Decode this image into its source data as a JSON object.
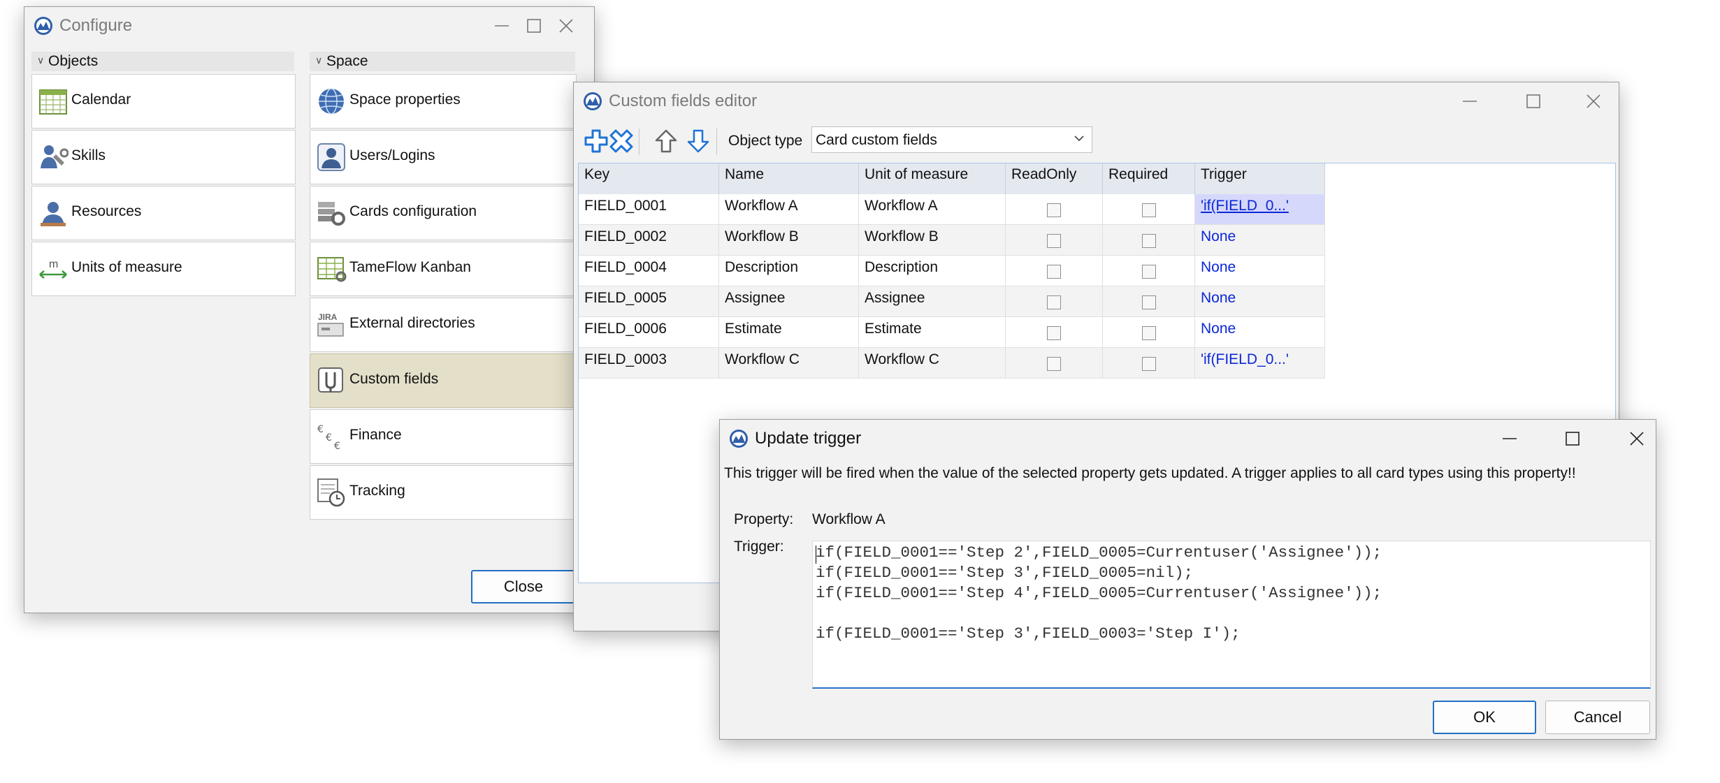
{
  "configure": {
    "title": "Configure",
    "objects_header": "Objects",
    "space_header": "Space",
    "objects": [
      {
        "label": "Calendar",
        "icon": "calendar-icon"
      },
      {
        "label": "Skills",
        "icon": "skills-icon"
      },
      {
        "label": "Resources",
        "icon": "resources-icon"
      },
      {
        "label": "Units of measure",
        "icon": "ruler-icon"
      }
    ],
    "space": [
      {
        "label": "Space properties",
        "icon": "globe-icon"
      },
      {
        "label": "Users/Logins",
        "icon": "user-icon"
      },
      {
        "label": "Cards configuration",
        "icon": "cards-gear-icon"
      },
      {
        "label": "TameFlow Kanban",
        "icon": "kanban-board-icon"
      },
      {
        "label": "External directories",
        "icon": "jira-icon"
      },
      {
        "label": "Custom fields",
        "icon": "custom-fields-icon",
        "selected": true
      },
      {
        "label": "Finance",
        "icon": "euro-icon"
      },
      {
        "label": "Tracking",
        "icon": "tracking-clock-icon"
      }
    ],
    "close_label": "Close"
  },
  "custom_fields": {
    "title": "Custom fields editor",
    "object_type_label": "Object type",
    "object_type_value": "Card custom fields",
    "columns": [
      "Key",
      "Name",
      "Unit of measure",
      "ReadOnly",
      "Required",
      "Trigger"
    ],
    "rows": [
      {
        "key": "FIELD_0001",
        "name": "Workflow A",
        "unit": "Workflow A",
        "readonly": false,
        "required": false,
        "trigger": "'if(FIELD_0...'"
      },
      {
        "key": "FIELD_0002",
        "name": "Workflow B",
        "unit": "Workflow B",
        "readonly": false,
        "required": false,
        "trigger": "None"
      },
      {
        "key": "FIELD_0004",
        "name": "Description",
        "unit": "Description",
        "readonly": false,
        "required": false,
        "trigger": "None"
      },
      {
        "key": "FIELD_0005",
        "name": "Assignee",
        "unit": "Assignee",
        "readonly": false,
        "required": false,
        "trigger": "None"
      },
      {
        "key": "FIELD_0006",
        "name": "Estimate",
        "unit": "Estimate",
        "readonly": false,
        "required": false,
        "trigger": "None"
      },
      {
        "key": "FIELD_0003",
        "name": "Workflow C",
        "unit": "Workflow C",
        "readonly": false,
        "required": false,
        "trigger": "'if(FIELD_0...'"
      }
    ]
  },
  "update_trigger": {
    "title": "Update trigger",
    "message": "This trigger will be fired when the value of the selected property gets updated. A trigger applies to all card types using this property!!",
    "property_label": "Property:",
    "property_value": "Workflow A",
    "trigger_label": "Trigger:",
    "code_lines": [
      "if(FIELD_0001=='Step 2',FIELD_0005=Currentuser('Assignee'));",
      "if(FIELD_0001=='Step 3',FIELD_0005=nil);",
      "if(FIELD_0001=='Step 4',FIELD_0005=Currentuser('Assignee'));",
      "",
      "if(FIELD_0001=='Step 3',FIELD_0003='Step I');"
    ],
    "ok_label": "OK",
    "cancel_label": "Cancel"
  },
  "colors": {
    "accent": "#1f6fc5",
    "selected_tile": "#e3dfc8",
    "link": "#0b27d6",
    "active_cell": "#d5d8fb"
  }
}
